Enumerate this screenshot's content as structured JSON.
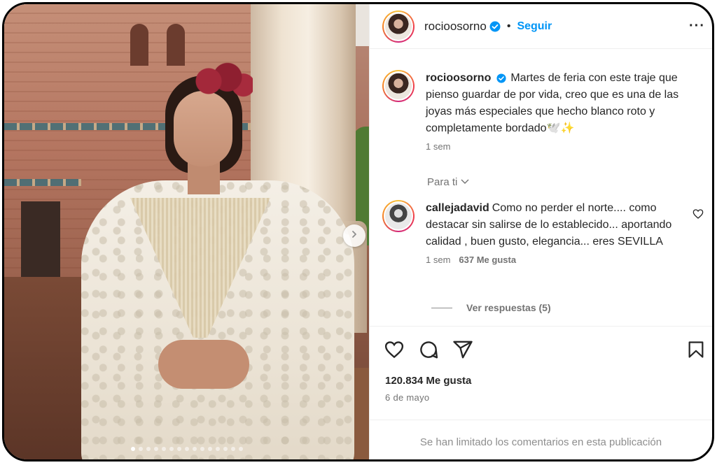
{
  "post": {
    "username": "rocioosorno",
    "follow_label": "Seguir",
    "separator": "•",
    "more_label": "···"
  },
  "caption": {
    "username": "rocioosorno",
    "text": "Martes de feria con este traje que pienso guardar de por vida, creo que es una de las joyas más especiales que hecho blanco roto y completamente bordado🕊️✨",
    "time": "1 sem"
  },
  "sort": {
    "label": "Para ti"
  },
  "top_comment": {
    "username": "callejadavid",
    "text": "Como no perder el norte.... como destacar sin salirse de lo establecido... aportando calidad , buen gusto, elegancia... eres SEVILLA",
    "time": "1 sem",
    "likes": "637 Me gusta"
  },
  "replies": {
    "label": "Ver respuestas (5)"
  },
  "stats": {
    "likes": "120.834 Me gusta",
    "date": "6 de mayo"
  },
  "footer": {
    "limited_comments": "Se han limitado los comentarios en esta publicación"
  },
  "carousel": {
    "total_slides": 15,
    "current_slide": 1
  },
  "colors": {
    "accent": "#0095f6",
    "verified": "#0095f6",
    "muted": "#737373"
  },
  "icons": [
    "verified-icon",
    "more-icon",
    "heart-icon",
    "comment-icon",
    "share-icon",
    "bookmark-icon",
    "chevron-right-icon",
    "chevron-down-icon"
  ]
}
